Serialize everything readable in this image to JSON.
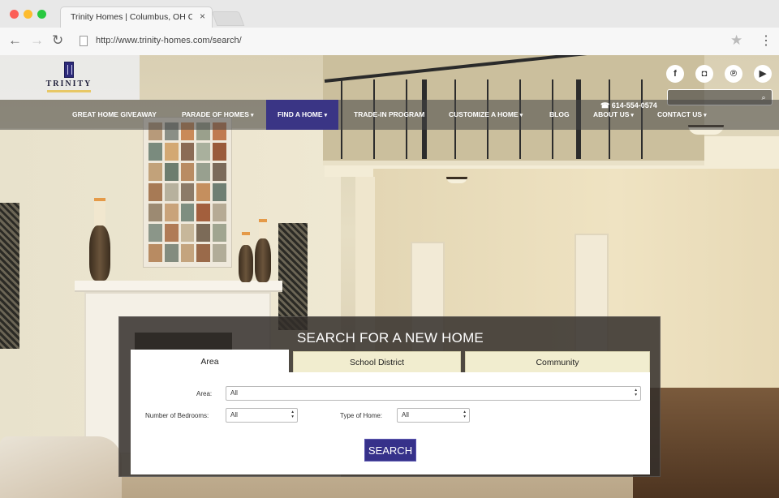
{
  "browser": {
    "tab_title": "Trinity Homes | Columbus, OH Cust...",
    "tab_close": "×",
    "url": "http://www.trinity-homes.com/search/",
    "back_glyph": "←",
    "forward_glyph": "→",
    "reload_glyph": "↻",
    "star_glyph": "★",
    "menu_glyph": "⋮"
  },
  "header": {
    "logo_text": "TRINITY",
    "phone": "614-554-0574",
    "phone_icon": "☎",
    "search_placeholder": "",
    "search_icon": "⌕",
    "social": [
      {
        "name": "facebook-icon",
        "glyph": "f"
      },
      {
        "name": "instagram-icon",
        "glyph": "◘"
      },
      {
        "name": "pinterest-icon",
        "glyph": "℗"
      },
      {
        "name": "youtube-icon",
        "glyph": "▶"
      }
    ]
  },
  "nav": {
    "items": [
      {
        "label": "GREAT HOME GIVEAWAY",
        "caret": ""
      },
      {
        "label": "PARADE OF HOMES",
        "caret": "▾"
      },
      {
        "label": "FIND A HOME",
        "caret": "▾"
      },
      {
        "label": "TRADE-IN PROGRAM",
        "caret": ""
      },
      {
        "label": "CUSTOMIZE A HOME",
        "caret": "▾"
      },
      {
        "label": "BLOG",
        "caret": ""
      },
      {
        "label": "ABOUT US",
        "caret": "▾"
      },
      {
        "label": "CONTACT US",
        "caret": "▾"
      }
    ],
    "active_index": 2
  },
  "search": {
    "title": "SEARCH FOR A NEW HOME",
    "tabs": [
      {
        "label": "Area"
      },
      {
        "label": "School District"
      },
      {
        "label": "Community"
      }
    ],
    "area_label": "Area:",
    "area_value": "All",
    "bedrooms_label": "Number of Bedrooms:",
    "bedrooms_value": "All",
    "type_label": "Type of Home:",
    "type_value": "All",
    "submit_label": "SEARCH"
  },
  "colors": {
    "nav_active": "#3a3585",
    "button": "#36318a",
    "tab_inactive": "#f1edcf"
  }
}
